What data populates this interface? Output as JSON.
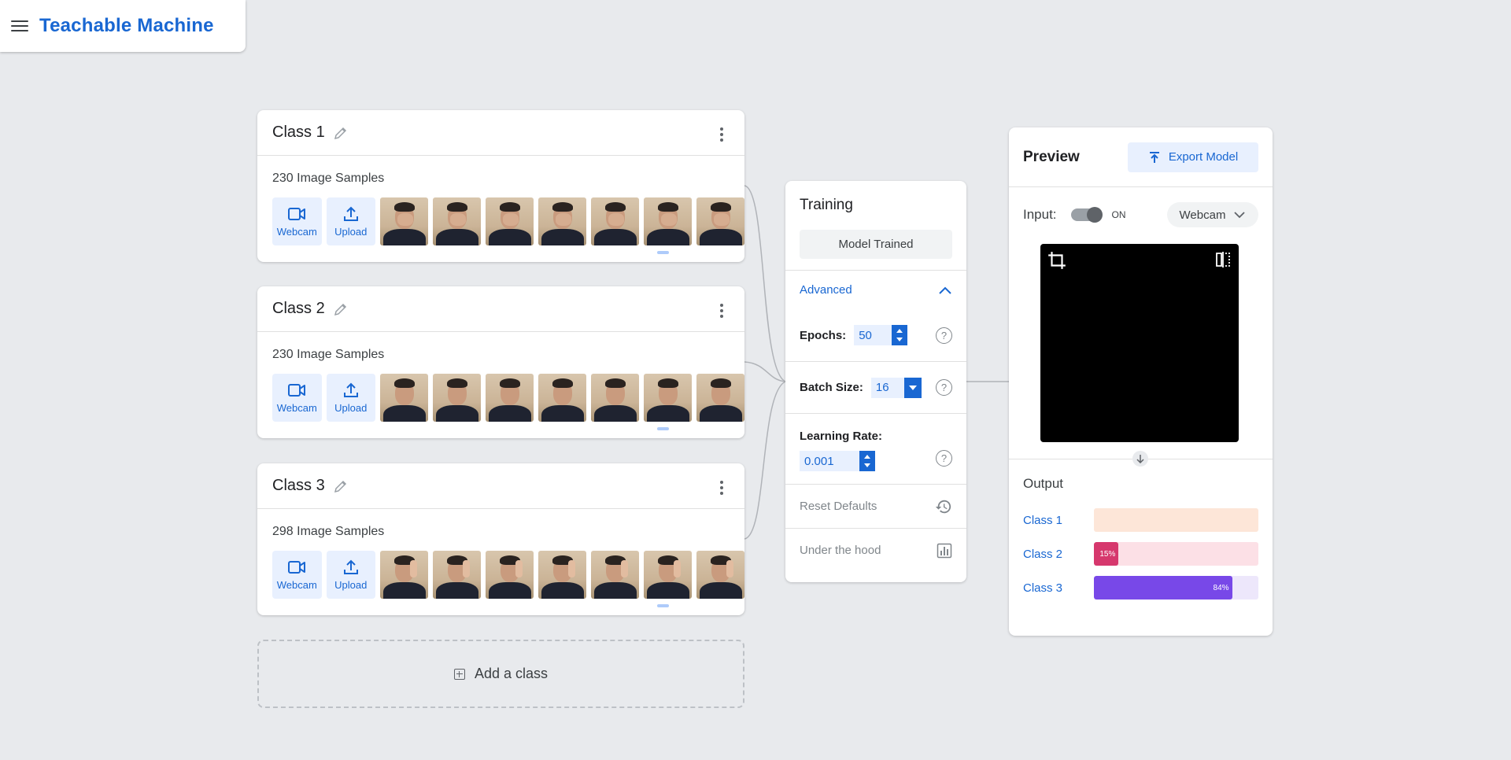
{
  "header": {
    "title": "Teachable Machine"
  },
  "classes": [
    {
      "name": "Class 1",
      "samples": "230 Image Samples",
      "pose": "hand",
      "webcam_label": "Webcam",
      "upload_label": "Upload"
    },
    {
      "name": "Class 2",
      "samples": "230 Image Samples",
      "pose": "none",
      "webcam_label": "Webcam",
      "upload_label": "Upload"
    },
    {
      "name": "Class 3",
      "samples": "298 Image Samples",
      "pose": "peace",
      "webcam_label": "Webcam",
      "upload_label": "Upload"
    }
  ],
  "add_class_label": "Add a class",
  "training": {
    "title": "Training",
    "status_button": "Model Trained",
    "advanced_label": "Advanced",
    "epochs_label": "Epochs:",
    "epochs_value": "50",
    "batch_label": "Batch Size:",
    "batch_value": "16",
    "lr_label": "Learning Rate:",
    "lr_value": "0.001",
    "reset_label": "Reset Defaults",
    "hood_label": "Under the hood",
    "help_glyph": "?"
  },
  "preview": {
    "title": "Preview",
    "export_label": "Export Model",
    "input_label": "Input:",
    "toggle_state": "ON",
    "source": "Webcam",
    "output_title": "Output",
    "outputs": [
      {
        "label": "Class 1",
        "percent": 0,
        "percent_label": "",
        "color": "#f5a263",
        "track": "#fde6d8"
      },
      {
        "label": "Class 2",
        "percent": 15,
        "percent_label": "15%",
        "color": "#d6386d",
        "track": "#fce0e6"
      },
      {
        "label": "Class 3",
        "percent": 84,
        "percent_label": "84%",
        "color": "#7848e8",
        "track": "#ede7fb"
      }
    ]
  },
  "colors": {
    "accent": "#1967d2",
    "background": "#e8eaed"
  }
}
